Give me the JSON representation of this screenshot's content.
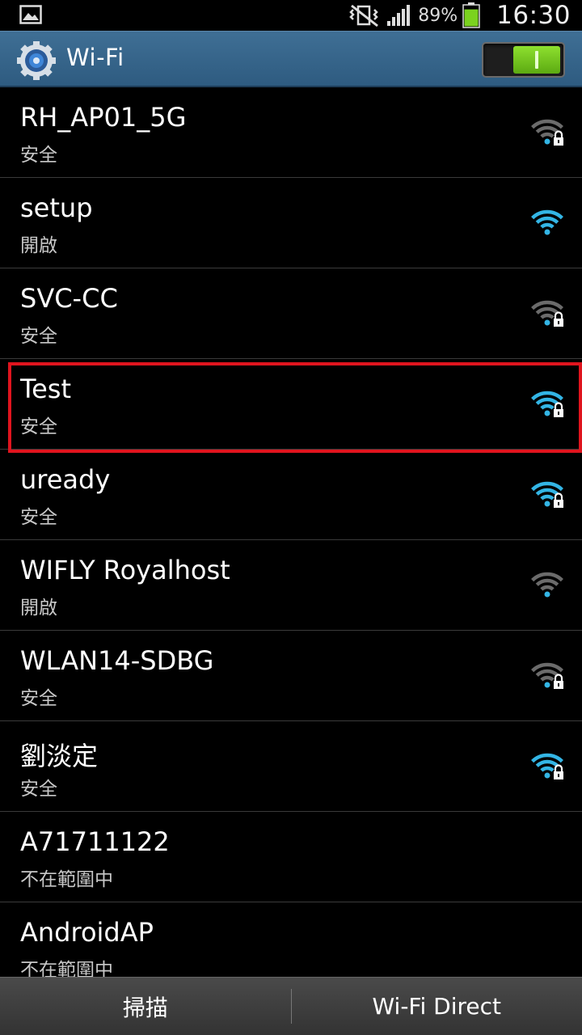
{
  "status_bar": {
    "battery_percent": "89%",
    "battery_level": 0.89,
    "time": "16:30"
  },
  "action_bar": {
    "title": "Wi-Fi",
    "wifi_enabled": true
  },
  "networks": [
    {
      "ssid": "RH_AP01_5G",
      "status": "安全",
      "secured": true,
      "strength": "weak"
    },
    {
      "ssid": "setup",
      "status": "開啟",
      "secured": false,
      "strength": "strong"
    },
    {
      "ssid": "SVC-CC",
      "status": "安全",
      "secured": true,
      "strength": "weak"
    },
    {
      "ssid": "Test",
      "status": "安全",
      "secured": true,
      "strength": "strong",
      "highlighted": true
    },
    {
      "ssid": "uready",
      "status": "安全",
      "secured": true,
      "strength": "strong"
    },
    {
      "ssid": "WIFLY Royalhost",
      "status": "開啟",
      "secured": false,
      "strength": "weak"
    },
    {
      "ssid": "WLAN14-SDBG",
      "status": "安全",
      "secured": true,
      "strength": "weak"
    },
    {
      "ssid": "劉淡定",
      "status": "安全",
      "secured": true,
      "strength": "strong"
    },
    {
      "ssid": "A71711122",
      "status": "不在範圍中",
      "secured": false,
      "strength": "none"
    },
    {
      "ssid": "AndroidAP",
      "status": "不在範圍中",
      "secured": false,
      "strength": "none"
    }
  ],
  "bottom_bar": {
    "scan_label": "掃描",
    "wifi_direct_label": "Wi-Fi Direct"
  },
  "colors": {
    "action_bar": "#3a6a90",
    "signal_active": "#33b5e5",
    "signal_inactive": "#6b6b6b",
    "highlight_border": "#e0141e",
    "toggle_on": "#7bd21f"
  },
  "icons": {
    "status_left": "gallery-icon",
    "status_right": [
      "mute-vibrate-icon",
      "cell-signal-icon",
      "battery-icon"
    ],
    "action_bar": "settings-gear-icon",
    "row_trailing": "wifi-signal-icon"
  }
}
